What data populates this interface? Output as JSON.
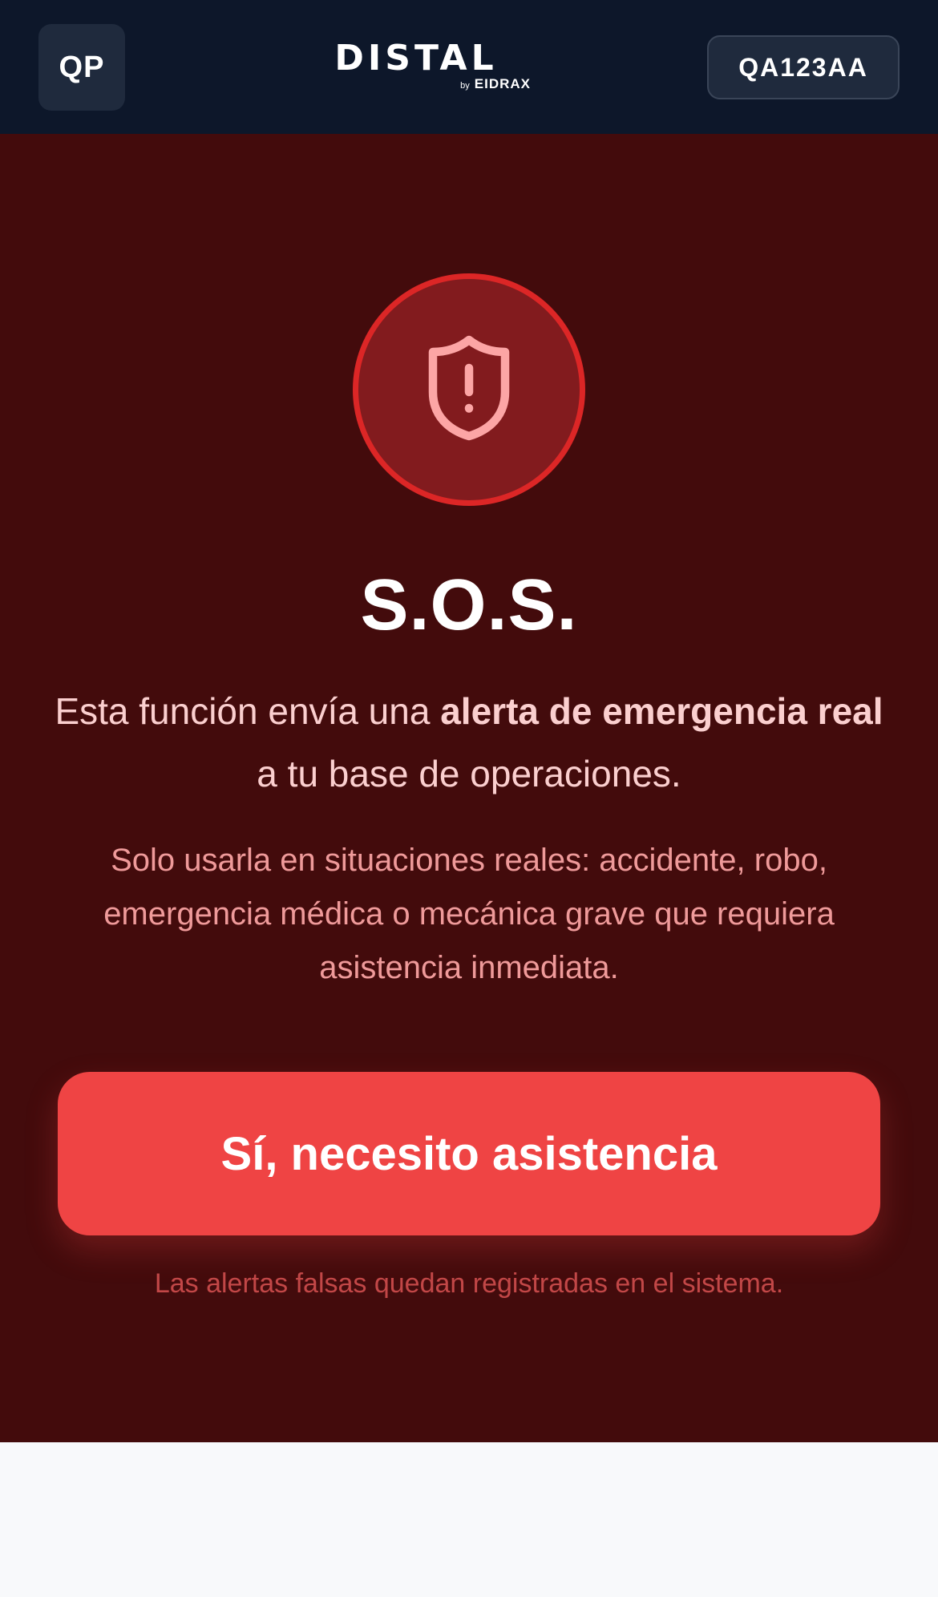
{
  "header": {
    "avatar_initials": "QP",
    "logo_text": "DISTAL",
    "logo_by": "by",
    "logo_brand": "EIDRAX",
    "vehicle_plate": "QA123AA"
  },
  "sos": {
    "icon": "shield-alert-icon",
    "title": "S.O.S.",
    "lead_prefix": "Esta función envía una ",
    "lead_bold": "alerta de emergencia real",
    "lead_suffix": " a tu base de operaciones.",
    "note": "Solo usarla en situaciones reales: accidente, robo, emergencia médica o mecánica grave que requiera asistencia inmediata.",
    "confirm_button": "Sí, necesito asistencia",
    "footnote": "Las alertas falsas quedan registradas en el sistema."
  },
  "colors": {
    "header_bg": "#0d172a",
    "panel_bg": "#430b0c",
    "accent": "#ef4444",
    "ring": "#dc2626"
  }
}
